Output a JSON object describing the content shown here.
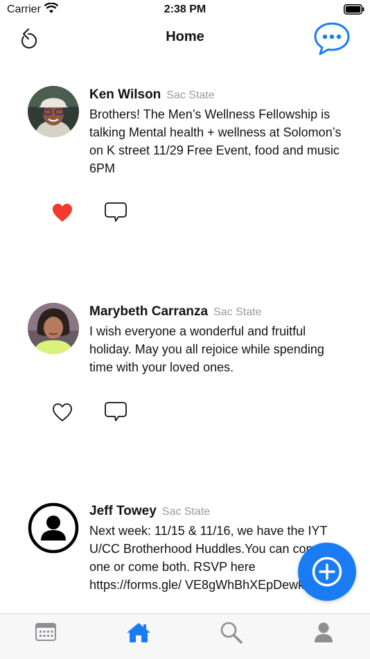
{
  "status_bar": {
    "carrier": "Carrier",
    "time": "2:38 PM"
  },
  "nav": {
    "title": "Home"
  },
  "posts": [
    {
      "author": "Ken Wilson",
      "school": "Sac State",
      "text": "Brothers! The Men’s Wellness Fellowship is talking Mental health + wellness at Solomon’s on K street 11/29 Free Event, food and music 6PM",
      "liked": true
    },
    {
      "author": "Marybeth Carranza",
      "school": "Sac State",
      "text": "I wish everyone a wonderful and fruitful holiday. May you all rejoice while spending time with your loved ones.",
      "liked": false
    },
    {
      "author": "Jeff Towey",
      "school": "Sac State",
      "text": "Next week: 11/15 & 11/16, we have the IYT U/CC Brotherhood Huddles.You can come to one or come both. RSVP here https://forms.gle/ VE8gWhBhXEpDewkW9",
      "liked": false
    }
  ],
  "tabs": [
    "calendar",
    "home",
    "search",
    "profile"
  ],
  "active_tab": "home",
  "colors": {
    "accent": "#1a7cf5",
    "like": "#f23a2f",
    "inactive_icon": "#8e8e93"
  }
}
